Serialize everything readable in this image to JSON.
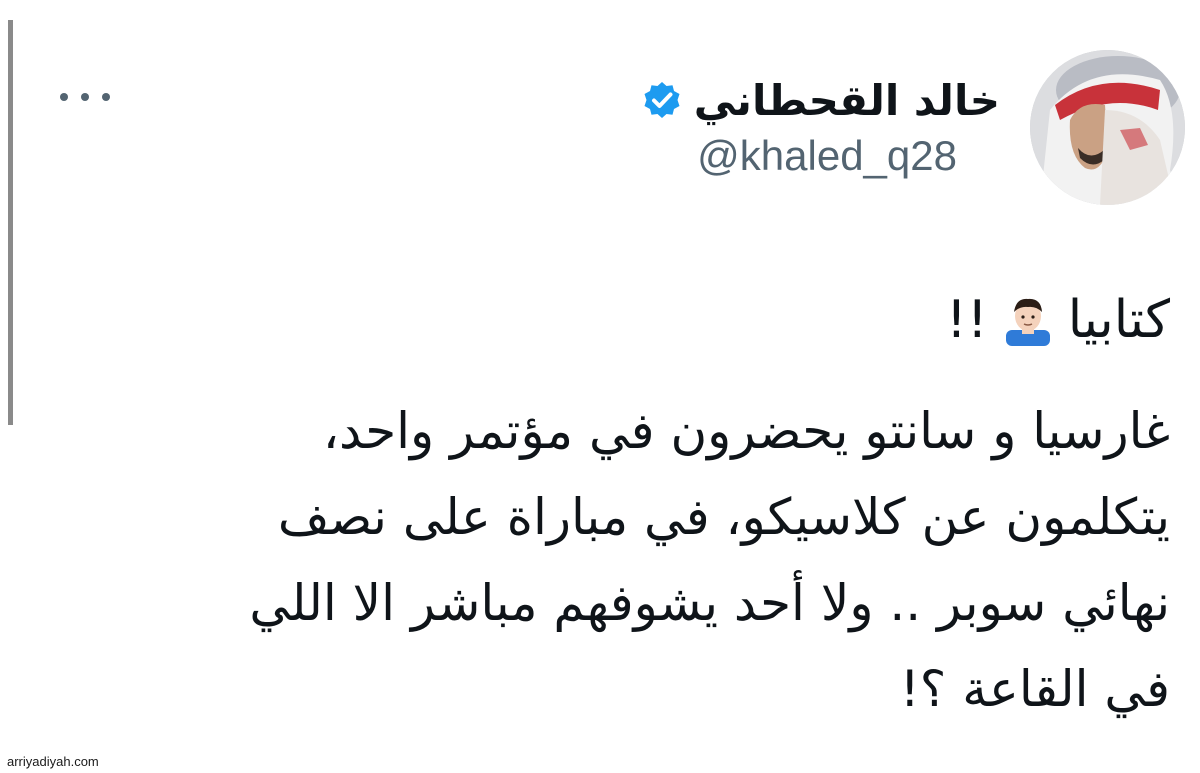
{
  "tweet": {
    "author": {
      "display_name": "خالد القحطاني",
      "handle": "@khaled_q28",
      "verified_icon": "verified-badge-icon",
      "avatar": "avatar"
    },
    "more_icon": "more-options-icon",
    "text_line1": "كتابيا",
    "text_line1_suffix": "!!",
    "emoji": "person-emoji-icon",
    "body_lines": [
      "غارسيا و سانتو يحضرون في مؤتمر واحد،",
      "يتكلمون عن كلاسيكو، في مباراة على نصف",
      "نهائي سوبر .. ولا أحد يشوفهم مباشر الا اللي",
      "في القاعة ؟!"
    ]
  },
  "watermark": "arriyadiyah.com",
  "colors": {
    "text": "#0f1419",
    "secondary": "#536471",
    "verified_blue": "#1d9bf0"
  }
}
